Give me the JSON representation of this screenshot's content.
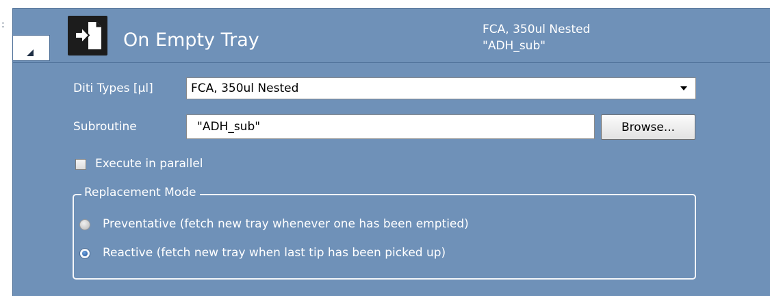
{
  "colors": {
    "panel_bg": "#6f91b8",
    "panel_border": "#4d6f97",
    "text": "#ffffff",
    "icon_bg": "#1c1c1c"
  },
  "header": {
    "icon": "tray-swap-icon",
    "title": "On Empty Tray",
    "summary_line1": "FCA, 350ul Nested",
    "summary_line2": "\"ADH_sub\""
  },
  "form": {
    "diti_types": {
      "label": "Diti Types [µl]",
      "selected": "FCA, 350ul Nested"
    },
    "subroutine": {
      "label": "Subroutine",
      "value": "\"ADH_sub\"",
      "browse_label": "Browse..."
    },
    "execute_parallel": {
      "label": "Execute in parallel",
      "checked": false
    },
    "replacement_mode": {
      "legend": "Replacement Mode",
      "options": [
        {
          "label": "Preventative (fetch new tray whenever one has been emptied)",
          "selected": false
        },
        {
          "label": "Reactive (fetch new tray when last tip has been picked up)",
          "selected": true
        }
      ]
    }
  }
}
